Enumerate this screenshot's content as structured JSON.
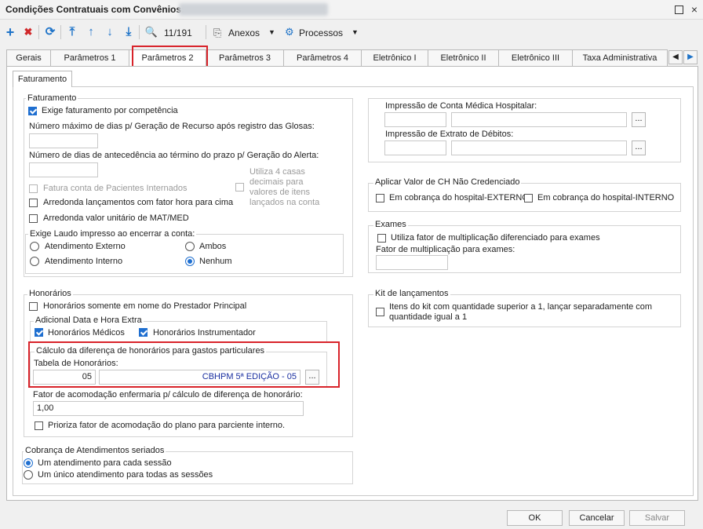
{
  "window": {
    "title": "Condições Contratuais com Convênios:",
    "minimize_icon": "square",
    "close_icon": "×"
  },
  "toolbar": {
    "add": "+",
    "delete": "✖",
    "refresh": "⟳",
    "first": "⤒",
    "up": "↑",
    "down": "↓",
    "last": "⤓",
    "search": "🔍",
    "record_counter": "11/191",
    "attachments": "Anexos",
    "processes": "Processos",
    "dropdown": "▼"
  },
  "tabs": [
    "Gerais",
    "Parâmetros 1",
    "Parâmetros 2",
    "Parâmetros 3",
    "Parâmetros 4",
    "Eletrônico I",
    "Eletrônico II",
    "Eletrônico III",
    "Taxa Administrativa"
  ],
  "subtab": "Faturamento",
  "faturamento": {
    "legend": "Faturamento",
    "exige_competencia": "Exige faturamento por competência",
    "max_dias_label": "Número máximo de dias p/ Geração de Recurso após registro das Glosas:",
    "max_dias_value": "",
    "dias_antecedencia_label": "Número de dias de antecedência ao término do prazo p/ Geração do Alerta:",
    "dias_antecedencia_value": "",
    "utiliza_4_casas": "Utiliza 4 casas decimais para valores de itens lançados na conta",
    "utiliza_4_casas_lines": [
      "Utiliza 4 casas",
      "decimais para",
      "valores de itens",
      "lançados na conta"
    ],
    "fatura_internados": "Fatura conta de Pacientes Internados",
    "arredonda_fator_hora": "Arredonda lançamentos com fator hora para cima",
    "arredonda_mat_med": "Arredonda valor unitário de MAT/MED",
    "laudo_legend": "Exige Laudo impresso ao encerrar a conta:",
    "laudo_options": [
      "Atendimento Externo",
      "Ambos",
      "Atendimento Interno",
      "Nenhum"
    ],
    "laudo_selected": "Nenhum"
  },
  "impressao": {
    "conta_medica_label": "Impressão de Conta Médica Hospitalar:",
    "extrato_label": "Impressão de Extrato de Débitos:"
  },
  "valor_ch": {
    "legend": "Aplicar Valor de CH Não Credenciado",
    "externo": "Em cobrança do hospital-EXTERNO",
    "interno": "Em cobrança do hospital-INTERNO"
  },
  "exames": {
    "legend": "Exames",
    "fator_diferenciado": "Utiliza fator de multiplicação diferenciado para exames",
    "fator_label": "Fator de multiplicação para exames:",
    "fator_value": ""
  },
  "kit": {
    "legend": "Kit de lançamentos",
    "itens_kit_lines": [
      "Itens do kit com quantidade superior a 1, lançar separadamente com",
      "quantidade igual a 1"
    ]
  },
  "honorarios": {
    "legend": "Honorários",
    "somente_prestador": "Honorários somente em nome do Prestador Principal",
    "adicional_legend": "Adicional Data e Hora Extra",
    "hon_medicos": "Honorários Médicos",
    "hon_instrumentador": "Honorários Instrumentador",
    "calculo_legend": "Cálculo da diferença de honorários para gastos particulares",
    "tabela_label": "Tabela de Honorários:",
    "tabela_code": "05",
    "tabela_name": "CBHPM 5ª EDIÇÃO - 05",
    "fator_acomodacao_label": "Fator de acomodação enfermaria p/ cálculo de diferença de honorário:",
    "fator_acomodacao_value": "1,00",
    "prioriza_fator": "Prioriza fator de acomodação do plano para parciente interno."
  },
  "cobranca": {
    "legend": "Cobrança de Atendimentos seriados",
    "options": [
      "Um atendimento para cada sessão",
      "Um único atendimento para todas as sessões"
    ],
    "selected": "Um atendimento para cada sessão"
  },
  "buttons": {
    "ok": "OK",
    "cancel": "Cancelar",
    "save": "Salvar",
    "ellipsis": "..."
  },
  "colors": {
    "accent": "#1f6fd0",
    "highlight": "#d8232a",
    "add": "#1e73c8",
    "delete": "#d0282a"
  }
}
